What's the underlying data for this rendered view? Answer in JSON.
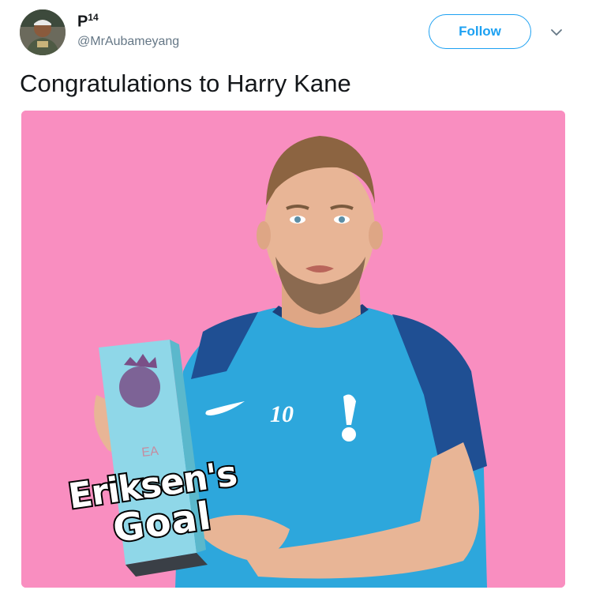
{
  "user": {
    "display_name": "P",
    "display_name_sup": "14",
    "handle": "@MrAubameyang",
    "avatar_icon": "user-avatar"
  },
  "actions": {
    "follow_label": "Follow",
    "caret_icon": "chevron-down-icon"
  },
  "tweet": {
    "text": "Congratulations to Harry Kane"
  },
  "media": {
    "background_color": "#f98ec0",
    "shirt_number": "10",
    "caption_line1": "Eriksen's",
    "caption_line2": "Goal",
    "trophy_logo_text": "EA"
  },
  "colors": {
    "accent": "#1da1f2",
    "text": "#14171a",
    "muted": "#657786"
  }
}
